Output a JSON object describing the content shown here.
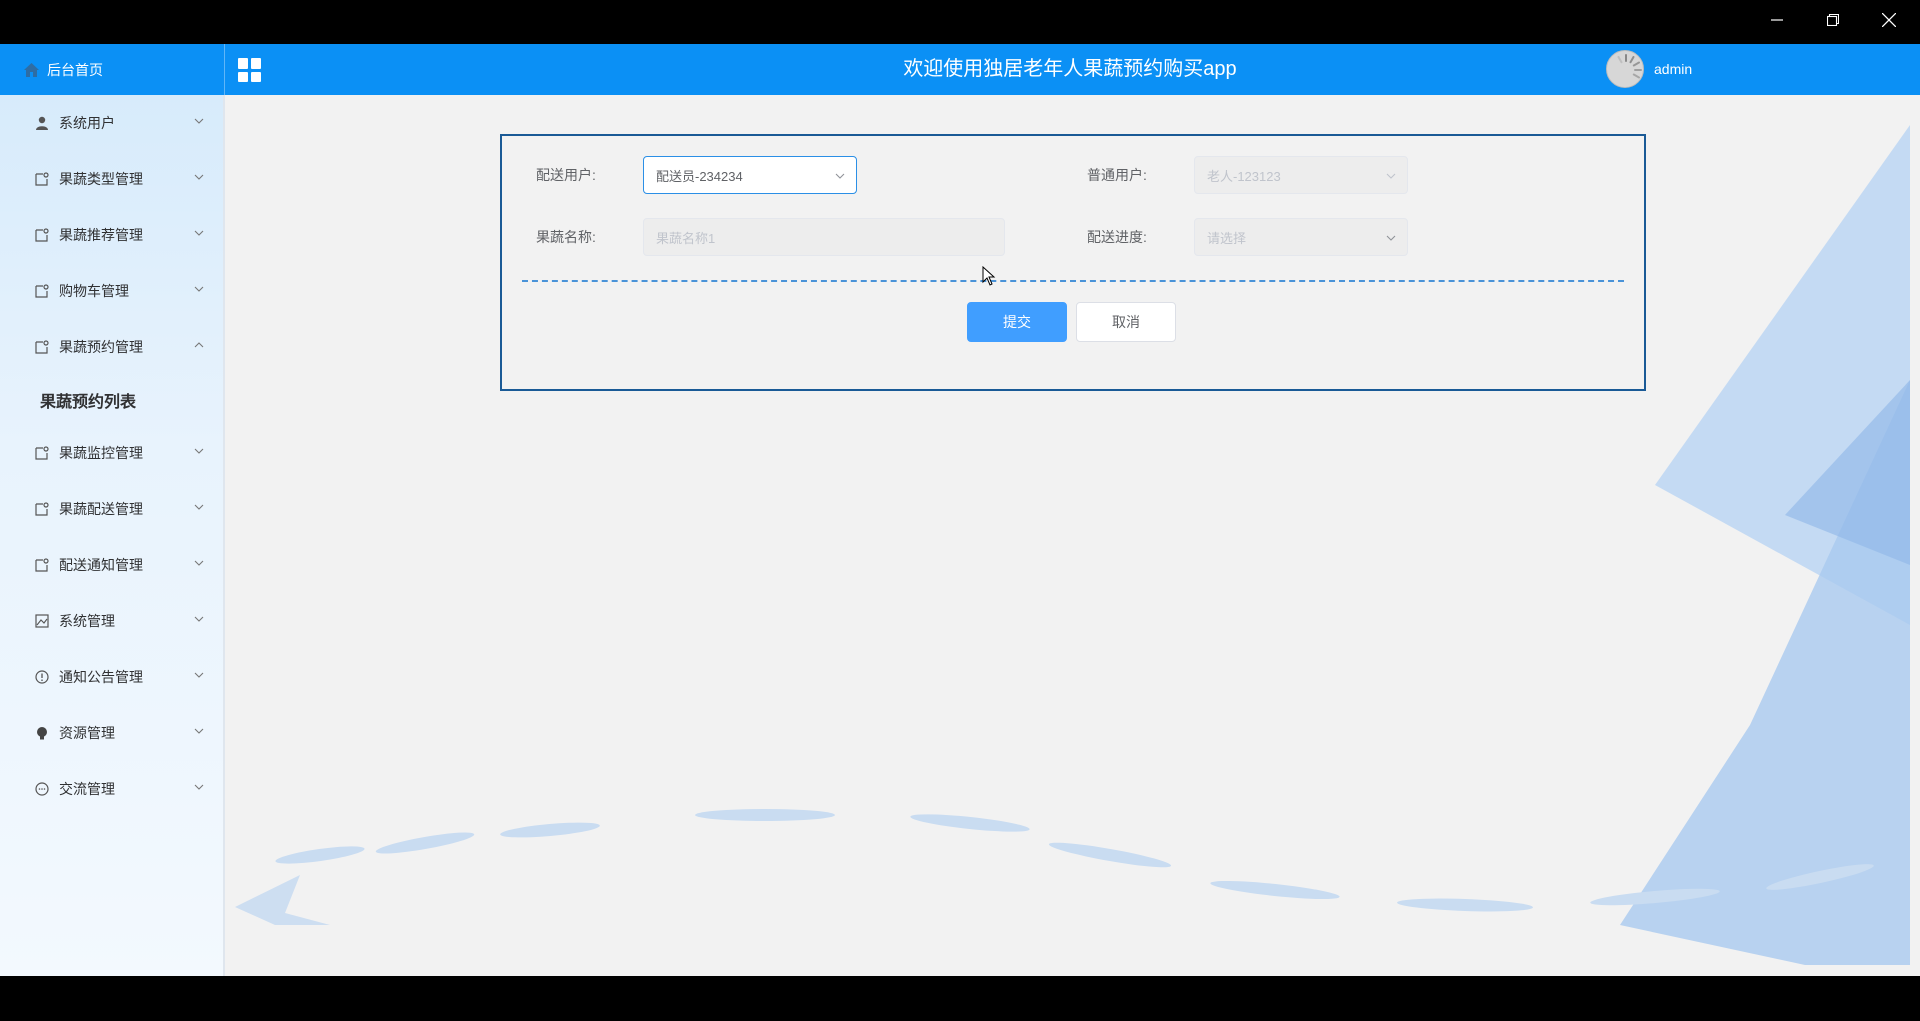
{
  "window": {
    "minimize_icon": "minimize-icon",
    "restore_icon": "restore-icon",
    "close_icon": "close-icon"
  },
  "header": {
    "home_label": "后台首页",
    "title": "欢迎使用独居老年人果蔬预约购买app",
    "username": "admin",
    "accent_color": "#0b90f5"
  },
  "sidebar": {
    "items": [
      {
        "label": "系统用户",
        "icon": "user-icon",
        "expanded": false
      },
      {
        "label": "果蔬类型管理",
        "icon": "tag-icon",
        "expanded": false
      },
      {
        "label": "果蔬推荐管理",
        "icon": "tag-icon",
        "expanded": false
      },
      {
        "label": "购物车管理",
        "icon": "tag-icon",
        "expanded": false
      },
      {
        "label": "果蔬预约管理",
        "icon": "tag-icon",
        "expanded": true
      },
      {
        "label": "果蔬监控管理",
        "icon": "tag-icon",
        "expanded": false
      },
      {
        "label": "果蔬配送管理",
        "icon": "tag-icon",
        "expanded": false
      },
      {
        "label": "配送通知管理",
        "icon": "tag-icon",
        "expanded": false
      },
      {
        "label": "系统管理",
        "icon": "picture-icon",
        "expanded": false
      },
      {
        "label": "通知公告管理",
        "icon": "warning-icon",
        "expanded": false
      },
      {
        "label": "资源管理",
        "icon": "bulb-icon",
        "expanded": false
      },
      {
        "label": "交流管理",
        "icon": "chat-icon",
        "expanded": false
      }
    ],
    "submenu": {
      "label": "果蔬预约列表"
    }
  },
  "form": {
    "delivery_user": {
      "label": "配送用户:",
      "value": "配送员-234234"
    },
    "normal_user": {
      "label": "普通用户:",
      "value": "老人-123123"
    },
    "produce_name": {
      "label": "果蔬名称:",
      "value": "果蔬名称1"
    },
    "delivery_progress": {
      "label": "配送进度:",
      "placeholder": "请选择"
    },
    "submit_label": "提交",
    "cancel_label": "取消",
    "primary_color": "#409eff"
  }
}
